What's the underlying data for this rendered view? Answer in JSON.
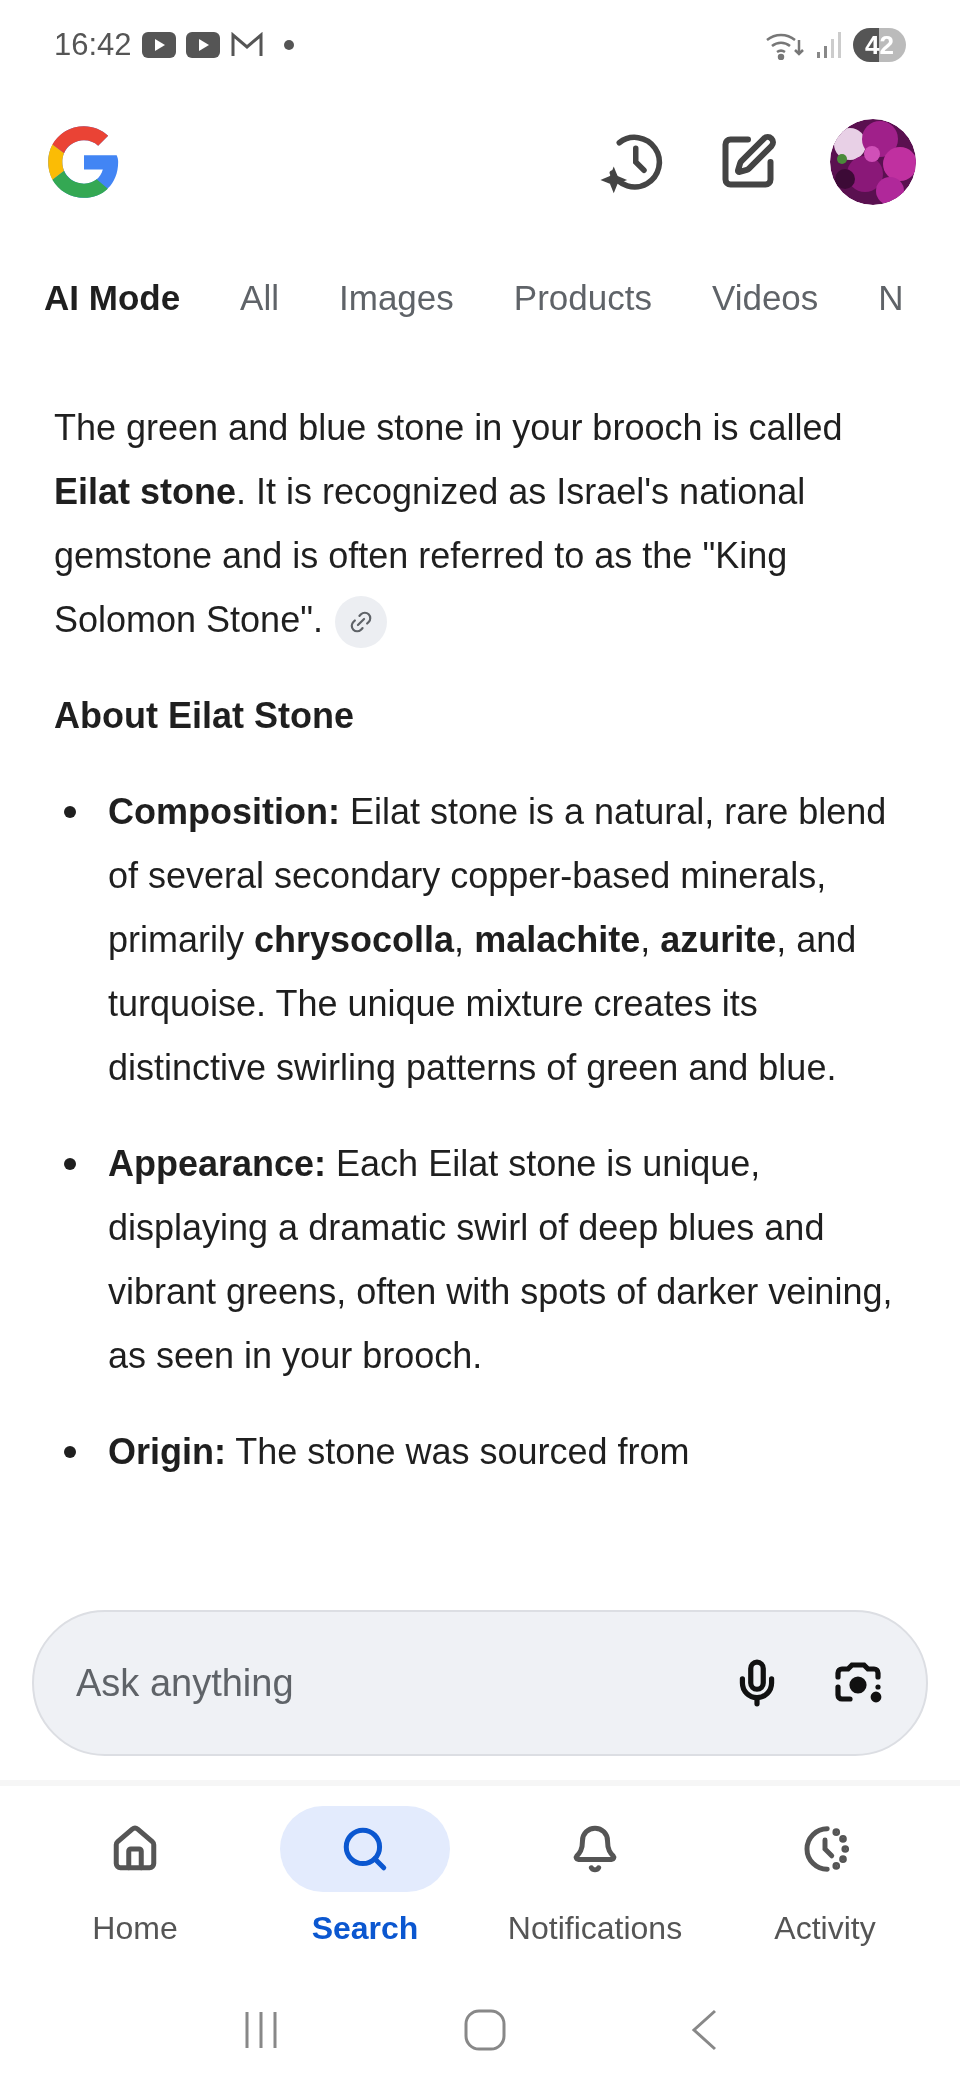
{
  "status_bar": {
    "time": "16:42",
    "battery": "42"
  },
  "tabs": [
    {
      "label": "AI Mode",
      "selected": true
    },
    {
      "label": "All",
      "selected": false
    },
    {
      "label": "Images",
      "selected": false
    },
    {
      "label": "Products",
      "selected": false
    },
    {
      "label": "Videos",
      "selected": false
    },
    {
      "label": "N",
      "selected": false
    }
  ],
  "answer": {
    "intro": "The green and blue stone in your brooch is called **Eilat stone**. It is recognized as Israel's national gemstone and is often referred to as the \"King Solomon Stone\".",
    "heading": "About Eilat Stone",
    "bullets": [
      "**Composition:** Eilat stone is a natural, rare blend of several secondary copper-based minerals, primarily **chrysocolla**, **malachite**, **azurite**, and turquoise. The unique mixture creates its distinctive swirling patterns of green and blue.",
      "**Appearance:** Each Eilat stone is unique, displaying a dramatic swirl of deep blues and vibrant greens, often with spots of darker veining, as seen in your brooch.",
      "**Origin:** The stone was sourced from"
    ]
  },
  "search": {
    "placeholder": "Ask anything"
  },
  "bottom_nav": [
    {
      "label": "Home",
      "kind": "home",
      "selected": false
    },
    {
      "label": "Search",
      "kind": "search",
      "selected": true
    },
    {
      "label": "Notifications",
      "kind": "bell",
      "selected": false
    },
    {
      "label": "Activity",
      "kind": "activity",
      "selected": false
    }
  ]
}
